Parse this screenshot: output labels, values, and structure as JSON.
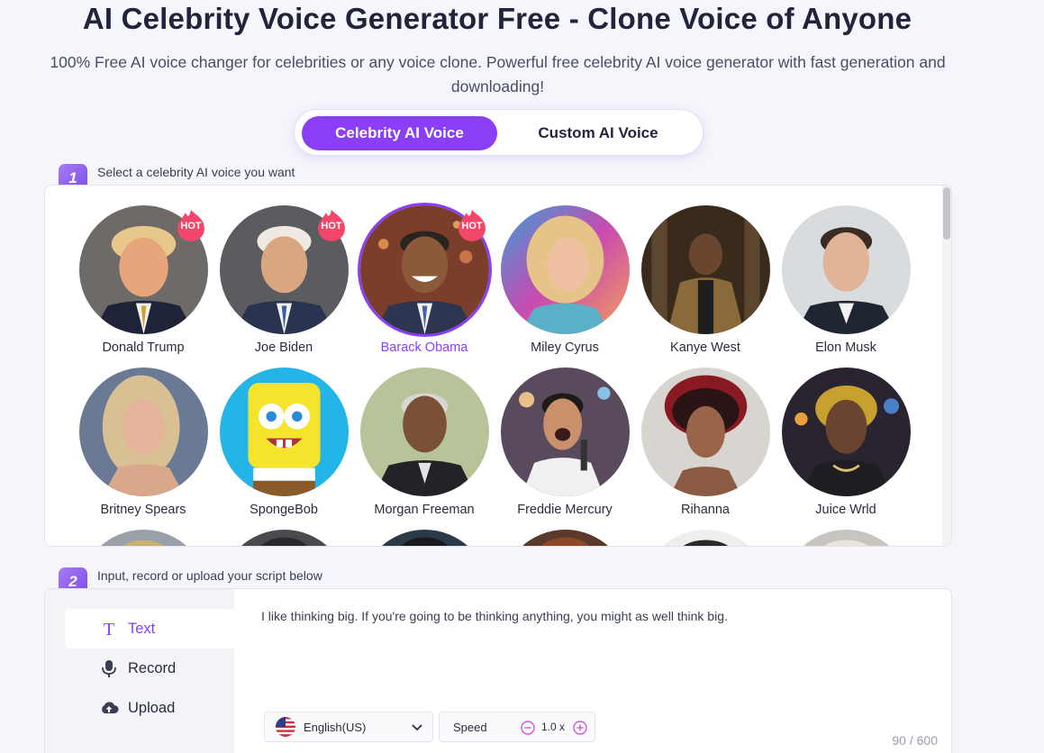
{
  "header": {
    "title": "AI Celebrity Voice Generator Free - Clone Voice of Anyone",
    "subtitle": "100% Free AI voice changer for celebrities or any voice clone. Powerful free celebrity AI voice generator with fast generation and downloading!"
  },
  "mode_tabs": [
    {
      "label": "Celebrity AI Voice",
      "active": true
    },
    {
      "label": "Custom AI Voice",
      "active": false
    }
  ],
  "step1": {
    "number": "1",
    "label": "Select a celebrity AI voice you want"
  },
  "voices": [
    {
      "name": "Donald Trump",
      "hot": true,
      "selected": false
    },
    {
      "name": "Joe Biden",
      "hot": true,
      "selected": false
    },
    {
      "name": "Barack Obama",
      "hot": true,
      "selected": true
    },
    {
      "name": "Miley Cyrus",
      "hot": false,
      "selected": false
    },
    {
      "name": "Kanye West",
      "hot": false,
      "selected": false
    },
    {
      "name": "Elon Musk",
      "hot": false,
      "selected": false
    },
    {
      "name": "Britney Spears",
      "hot": false,
      "selected": false
    },
    {
      "name": "SpongeBob",
      "hot": false,
      "selected": false
    },
    {
      "name": "Morgan Freeman",
      "hot": false,
      "selected": false
    },
    {
      "name": "Freddie Mercury",
      "hot": false,
      "selected": false
    },
    {
      "name": "Rihanna",
      "hot": false,
      "selected": false
    },
    {
      "name": "Juice Wrld",
      "hot": false,
      "selected": false
    }
  ],
  "hot_label": "HOT",
  "step2": {
    "number": "2",
    "label": "Input, record or upload your script below"
  },
  "input_modes": [
    {
      "label": "Text",
      "icon": "text-icon",
      "active": true
    },
    {
      "label": "Record",
      "icon": "microphone-icon",
      "active": false
    },
    {
      "label": "Upload",
      "icon": "cloud-upload-icon",
      "active": false
    }
  ],
  "script": {
    "text": "I like thinking big. If you're going to be thinking anything, you might as well think big."
  },
  "language": {
    "selected": "English(US)",
    "icon": "us-flag-icon"
  },
  "speed": {
    "label": "Speed",
    "value": "1.0 x"
  },
  "char_count": "90 / 600",
  "colors": {
    "accent": "#8a3ef6",
    "hot_badge": "#f2476a"
  }
}
